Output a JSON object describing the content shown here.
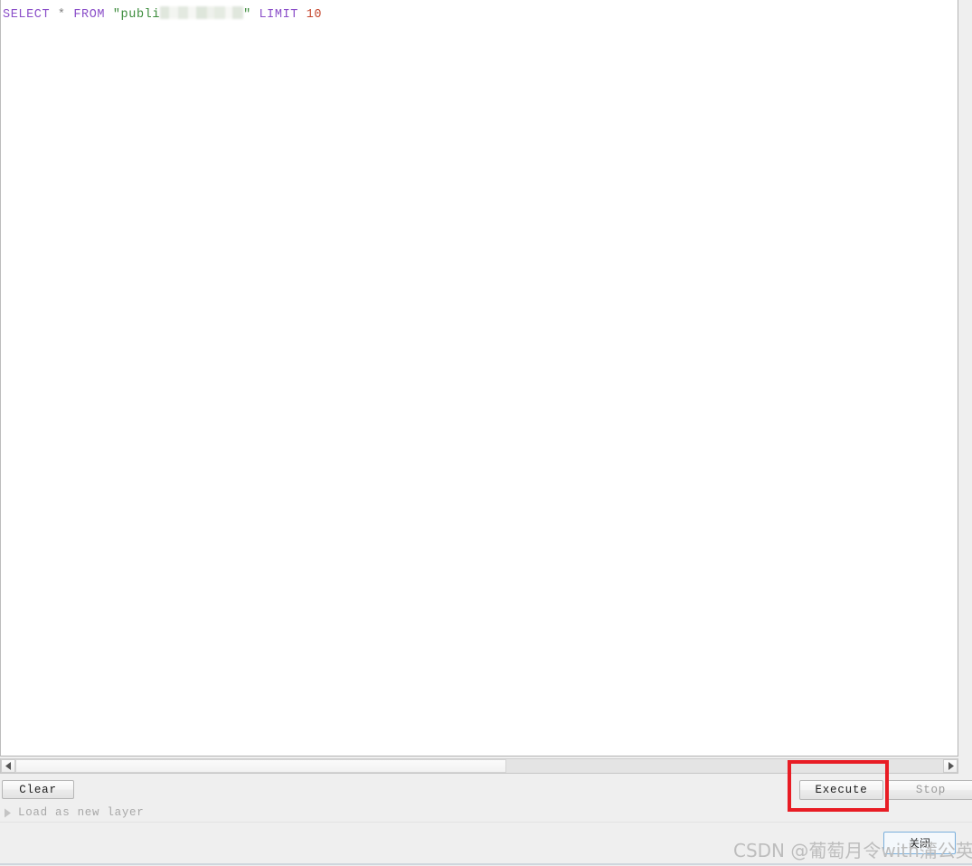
{
  "editor": {
    "sql": {
      "full_text": "SELECT * FROM \"publi████████\" LIMIT 10",
      "tokens": {
        "select": "SELECT",
        "star": "*",
        "from": "FROM",
        "open_quote": "\"",
        "schema_visible": "publi",
        "redacted_note": "blurred table name",
        "close_quote": "\"",
        "limit": "LIMIT",
        "limit_value": "10"
      },
      "colors": {
        "keyword": "#8b4fc9",
        "string": "#3c8c3c",
        "number": "#c4452c",
        "operator": "#808080"
      }
    }
  },
  "scrollbar": {
    "left_arrow_icon": "triangle-left-icon",
    "right_arrow_icon": "triangle-right-icon",
    "thumb_name": "horizontal-scroll-thumb"
  },
  "buttons": {
    "clear": "Clear",
    "execute": "Execute",
    "stop": "Stop",
    "close": "关闭"
  },
  "load_as_new_layer": {
    "label": "Load as new layer",
    "expander_icon": "triangle-right-icon",
    "expanded": false
  },
  "annotation": {
    "highlight_color": "#e81c24",
    "target": "Execute"
  },
  "watermark": {
    "text": "CSDN @葡萄月令with蒲公英"
  }
}
